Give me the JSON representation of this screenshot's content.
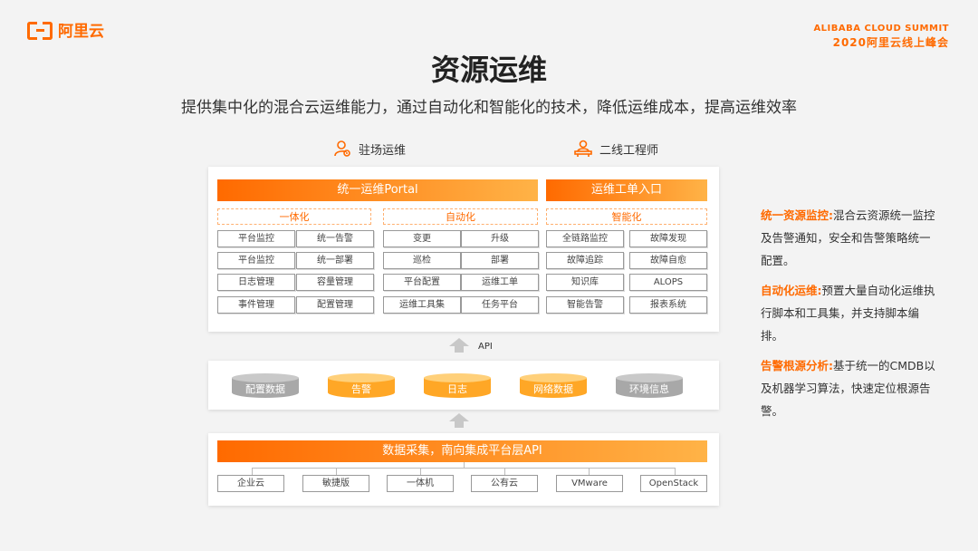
{
  "brand": {
    "logo_text": "阿里云",
    "summit_en": "ALIBABA CLOUD SUMMIT",
    "summit_cn": "2020阿里云线上峰会"
  },
  "page": {
    "title": "资源运维",
    "subtitle": "提供集中化的混合云运维能力，通过自动化和智能化的技术，降低运维成本，提高运维效率"
  },
  "roles": {
    "onsite": "驻场运维",
    "second_line": "二线工程师"
  },
  "portal": {
    "bar": "统一运维Portal",
    "ticket_bar": "运维工单入口",
    "groups": [
      {
        "label": "一体化",
        "items": [
          "平台监控",
          "统一告警",
          "平台监控",
          "统一部署",
          "日志管理",
          "容量管理",
          "事件管理",
          "配置管理"
        ]
      },
      {
        "label": "自动化",
        "items": [
          "变更",
          "升级",
          "巡检",
          "部署",
          "平台配置",
          "运维工单",
          "运维工具集",
          "任务平台"
        ]
      },
      {
        "label": "智能化",
        "items": [
          "全链路监控",
          "故障发现",
          "故障追踪",
          "故障自愈",
          "知识库",
          "ALOPS",
          "智能告警",
          "报表系统"
        ]
      }
    ]
  },
  "api_label": "API",
  "data_layer": {
    "items": [
      "配置数据",
      "告警",
      "日志",
      "网络数据",
      "环境信息"
    ]
  },
  "collect": {
    "bar": "数据采集，南向集成平台层API",
    "sources": [
      "企业云",
      "敏捷版",
      "一体机",
      "公有云",
      "VMware",
      "OpenStack"
    ]
  },
  "descriptions": [
    {
      "title": "统一资源监控:",
      "text": "混合云资源统一监控及告警通知，安全和告警策略统一配置。"
    },
    {
      "title": "自动化运维:",
      "text": "预置大量自动化运维执行脚本和工具集，并支持脚本编排。"
    },
    {
      "title": "告警根源分析:",
      "text": "基于统一的CMDB以及机器学习算法，快速定位根源告警。"
    }
  ],
  "colors": {
    "accent": "#ff6a00",
    "accent_light": "#ffb347",
    "gray_cyl": "#a8a8a8"
  }
}
